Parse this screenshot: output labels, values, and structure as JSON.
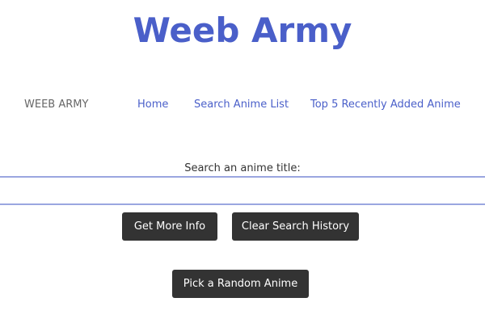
{
  "site": {
    "title": "Weeb Army"
  },
  "navbar": {
    "brand": "WEEB ARMY",
    "links": [
      {
        "label": "Home"
      },
      {
        "label": "Search Anime List"
      },
      {
        "label": "Top 5 Recently Added Anime"
      }
    ]
  },
  "search": {
    "label": "Search an anime title:",
    "value": "",
    "placeholder": ""
  },
  "buttons": {
    "more_info": "Get More Info",
    "clear_history": "Clear Search History",
    "random": "Pick a Random Anime"
  },
  "colors": {
    "accent": "#4a5fc9",
    "button_bg": "#333333",
    "input_border": "#9aa6e0"
  }
}
